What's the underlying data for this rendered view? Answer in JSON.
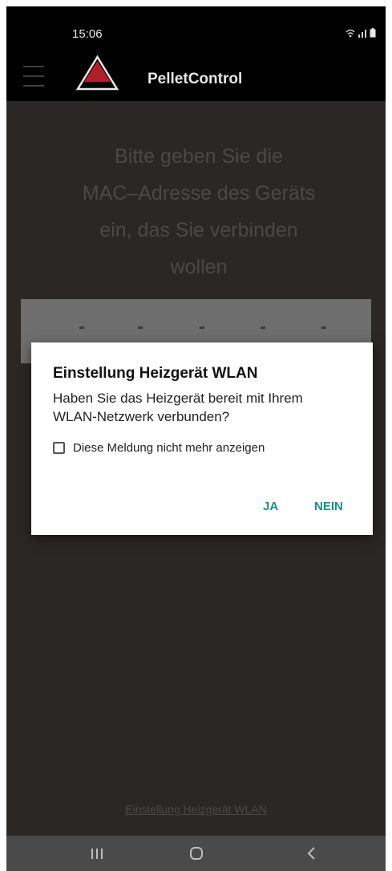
{
  "status_bar": {
    "time": "15:06",
    "icons": [
      "wifi-icon",
      "signal-icon",
      "battery-icon"
    ]
  },
  "app_bar": {
    "menu_icon": "hamburger-menu-icon",
    "logo_icon": "triangle-logo-icon",
    "title": "PelletControl"
  },
  "main": {
    "instruction_lines": [
      "Bitte geben Sie die",
      "MAC–Adresse des Geräts",
      "ein, das Sie verbinden",
      "wollen"
    ],
    "mac_segments": [
      "-",
      "-",
      "-",
      "-",
      "-"
    ]
  },
  "dialog": {
    "title": "Einstellung Heizgerät WLAN",
    "message": "Haben Sie das Heizgerät bereit mit Ihrem WLAN-Netzwerk verbunden?",
    "checkbox_label": "Diese Meldung nicht mehr anzeigen",
    "checkbox_checked": false,
    "buttons": {
      "yes": "JA",
      "no": "NEIN"
    }
  },
  "footer": {
    "link": "Einstellung Heizgerät WLAN"
  },
  "nav_bar": {
    "buttons": [
      "recents-icon",
      "home-icon",
      "back-icon"
    ]
  },
  "colors": {
    "background": "#2b2727",
    "accent": "#1a8f88",
    "logo_red": "#b0202a"
  }
}
